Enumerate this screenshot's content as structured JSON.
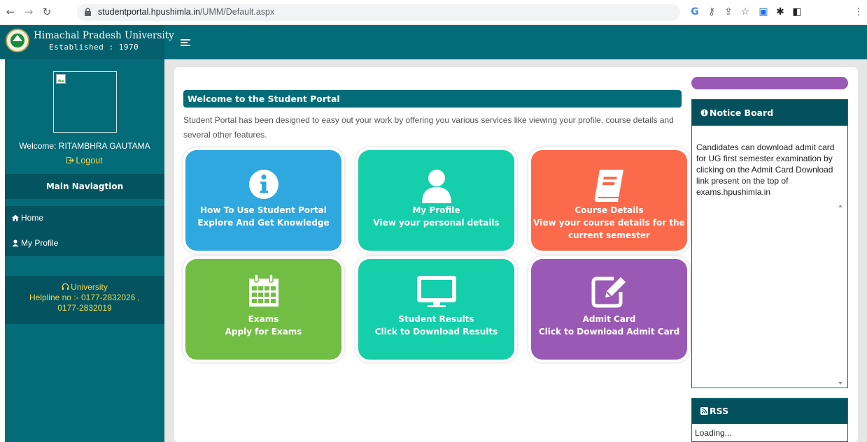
{
  "browser": {
    "url_host": "studentportal.hpushimla.in",
    "url_path": "/UMM/Default.aspx"
  },
  "header": {
    "title": "Himachal Pradesh University",
    "established": "Established : 1970"
  },
  "sidebar": {
    "welcome": "Welcome: RITAMBHRA GAUTAMA",
    "logout": "Logout",
    "nav_heading": "Main Naviagtion",
    "items": [
      {
        "label": "Home",
        "icon": "home-icon"
      },
      {
        "label": "My Profile",
        "icon": "user-icon"
      }
    ],
    "helpline_title": "University",
    "helpline_line1": "Helpline no :- 0177-2832026 ,",
    "helpline_line2": "0177-2832019"
  },
  "main": {
    "title": "Welcome to the Student Portal",
    "intro": "Student Portal has been designed to easy out your work by offering you various services like viewing your profile, course details and several other features.",
    "tiles": [
      {
        "line1": "How To Use Student Portal",
        "line2": "Explore And Get Knowledge",
        "line3": "",
        "color": "#2fa8e0",
        "icon": "info-icon"
      },
      {
        "line1": "My Profile",
        "line2": "View your personal details",
        "line3": "",
        "color": "#14cfaa",
        "icon": "user-icon"
      },
      {
        "line1": "Course Details",
        "line2": "View your course details for the",
        "line3": "current semester",
        "color": "#fc6a4c",
        "icon": "book-icon"
      },
      {
        "line1": "Exams",
        "line2": "Apply for Exams",
        "line3": "",
        "color": "#72be44",
        "icon": "calendar-icon"
      },
      {
        "line1": "Student Results",
        "line2": "Click to Download Results",
        "line3": "",
        "color": "#14cfaa",
        "icon": "monitor-icon"
      },
      {
        "line1": "Admit Card",
        "line2": "Click to Download Admit Card",
        "line3": "",
        "color": "#9b59b6",
        "icon": "edit-icon"
      }
    ]
  },
  "notice_board": {
    "title": "Notice Board",
    "text": "Candidates can download admit card for UG first semester examination by clicking on the Admit Card Download link present on the top of exams.hpushimla.in"
  },
  "rss": {
    "title": "RSS",
    "text": "Loading..."
  },
  "colors": {
    "primary": "#046b78",
    "dark": "#04505c",
    "accent_yellow": "#f2d648"
  }
}
